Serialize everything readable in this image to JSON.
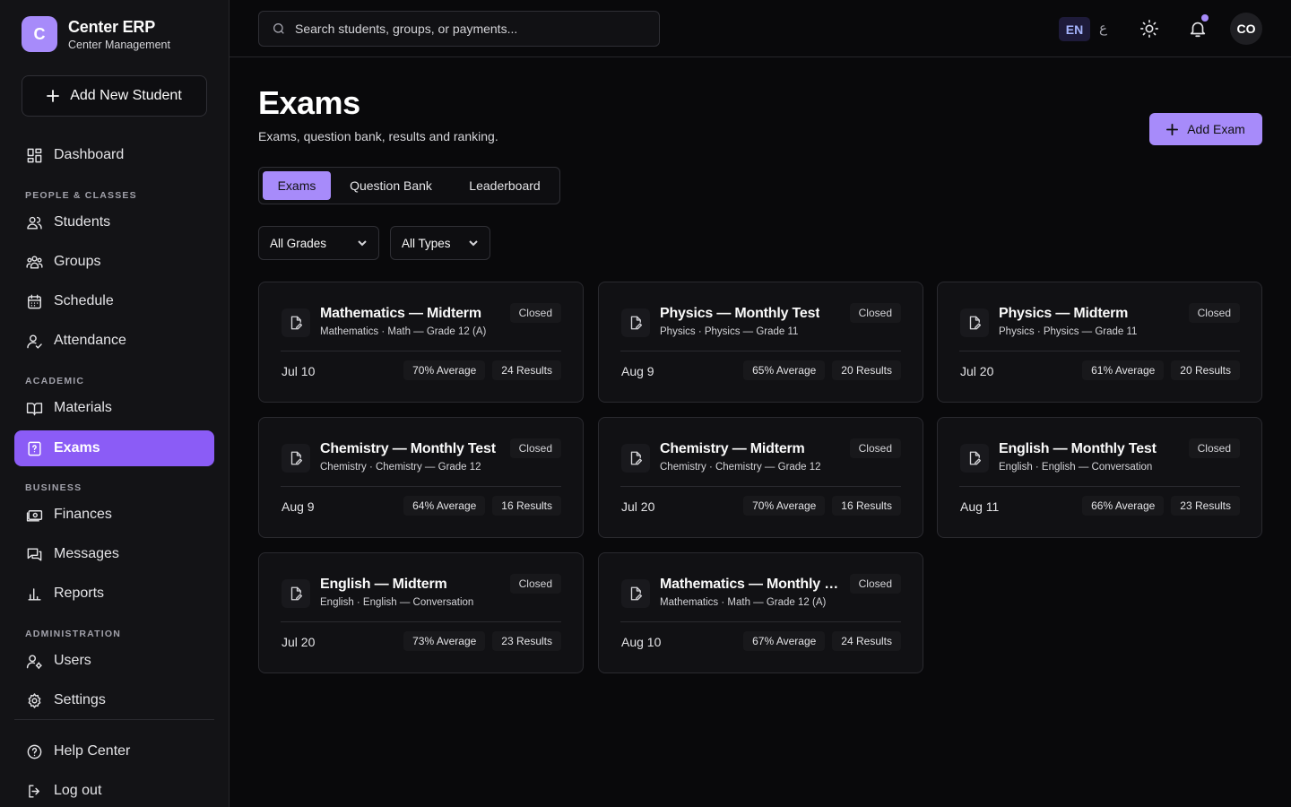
{
  "brand": {
    "logo_letter": "C",
    "name": "Center ERP",
    "subtitle": "Center Management"
  },
  "sidebar": {
    "add_student_label": "Add New Student",
    "dashboard": {
      "label": "Dashboard",
      "icon": "dashboard-icon"
    },
    "sections": {
      "people": "PEOPLE & CLASSES",
      "academic": "ACADEMIC",
      "business": "BUSINESS",
      "administration": "ADMINISTRATION"
    },
    "items": {
      "students": "Students",
      "groups": "Groups",
      "schedule": "Schedule",
      "attendance": "Attendance",
      "materials": "Materials",
      "exams": "Exams",
      "finances": "Finances",
      "messages": "Messages",
      "reports": "Reports",
      "users": "Users",
      "settings": "Settings",
      "help": "Help Center",
      "logout": "Log out"
    },
    "active": "exams"
  },
  "header": {
    "search_placeholder": "Search students, groups, or payments...",
    "lang_active": "EN",
    "lang_alt": "ع",
    "avatar_initials": "CO",
    "notification_dot": true
  },
  "page": {
    "title": "Exams",
    "subtitle": "Exams, question bank, results and ranking.",
    "add_button": "Add Exam",
    "tabs": [
      "Exams",
      "Question Bank",
      "Leaderboard"
    ],
    "active_tab": "Exams",
    "filters": {
      "grades": "All Grades",
      "types": "All Types"
    }
  },
  "exams": [
    {
      "title": "Mathematics — Midterm",
      "meta": "Mathematics · Math — Grade 12 (A)",
      "status": "Closed",
      "date": "Jul 10",
      "average": "70% Average",
      "results": "24 Results"
    },
    {
      "title": "Physics — Monthly Test",
      "meta": "Physics · Physics — Grade 11",
      "status": "Closed",
      "date": "Aug 9",
      "average": "65% Average",
      "results": "20 Results"
    },
    {
      "title": "Physics — Midterm",
      "meta": "Physics · Physics — Grade 11",
      "status": "Closed",
      "date": "Jul 20",
      "average": "61% Average",
      "results": "20 Results"
    },
    {
      "title": "Chemistry — Monthly Test",
      "meta": "Chemistry · Chemistry — Grade 12",
      "status": "Closed",
      "date": "Aug 9",
      "average": "64% Average",
      "results": "16 Results"
    },
    {
      "title": "Chemistry — Midterm",
      "meta": "Chemistry · Chemistry — Grade 12",
      "status": "Closed",
      "date": "Jul 20",
      "average": "70% Average",
      "results": "16 Results"
    },
    {
      "title": "English — Monthly Test",
      "meta": "English · English — Conversation",
      "status": "Closed",
      "date": "Aug 11",
      "average": "66% Average",
      "results": "23 Results"
    },
    {
      "title": "English — Midterm",
      "meta": "English · English — Conversation",
      "status": "Closed",
      "date": "Jul 20",
      "average": "73% Average",
      "results": "23 Results"
    },
    {
      "title": "Mathematics — Monthly Test",
      "meta": "Mathematics · Math — Grade 12 (A)",
      "status": "Closed",
      "date": "Aug 10",
      "average": "67% Average",
      "results": "24 Results"
    }
  ],
  "colors": {
    "accent": "#a78bfa",
    "accent_strong": "#8b5cf6",
    "background": "#09090b",
    "card": "#111114"
  }
}
